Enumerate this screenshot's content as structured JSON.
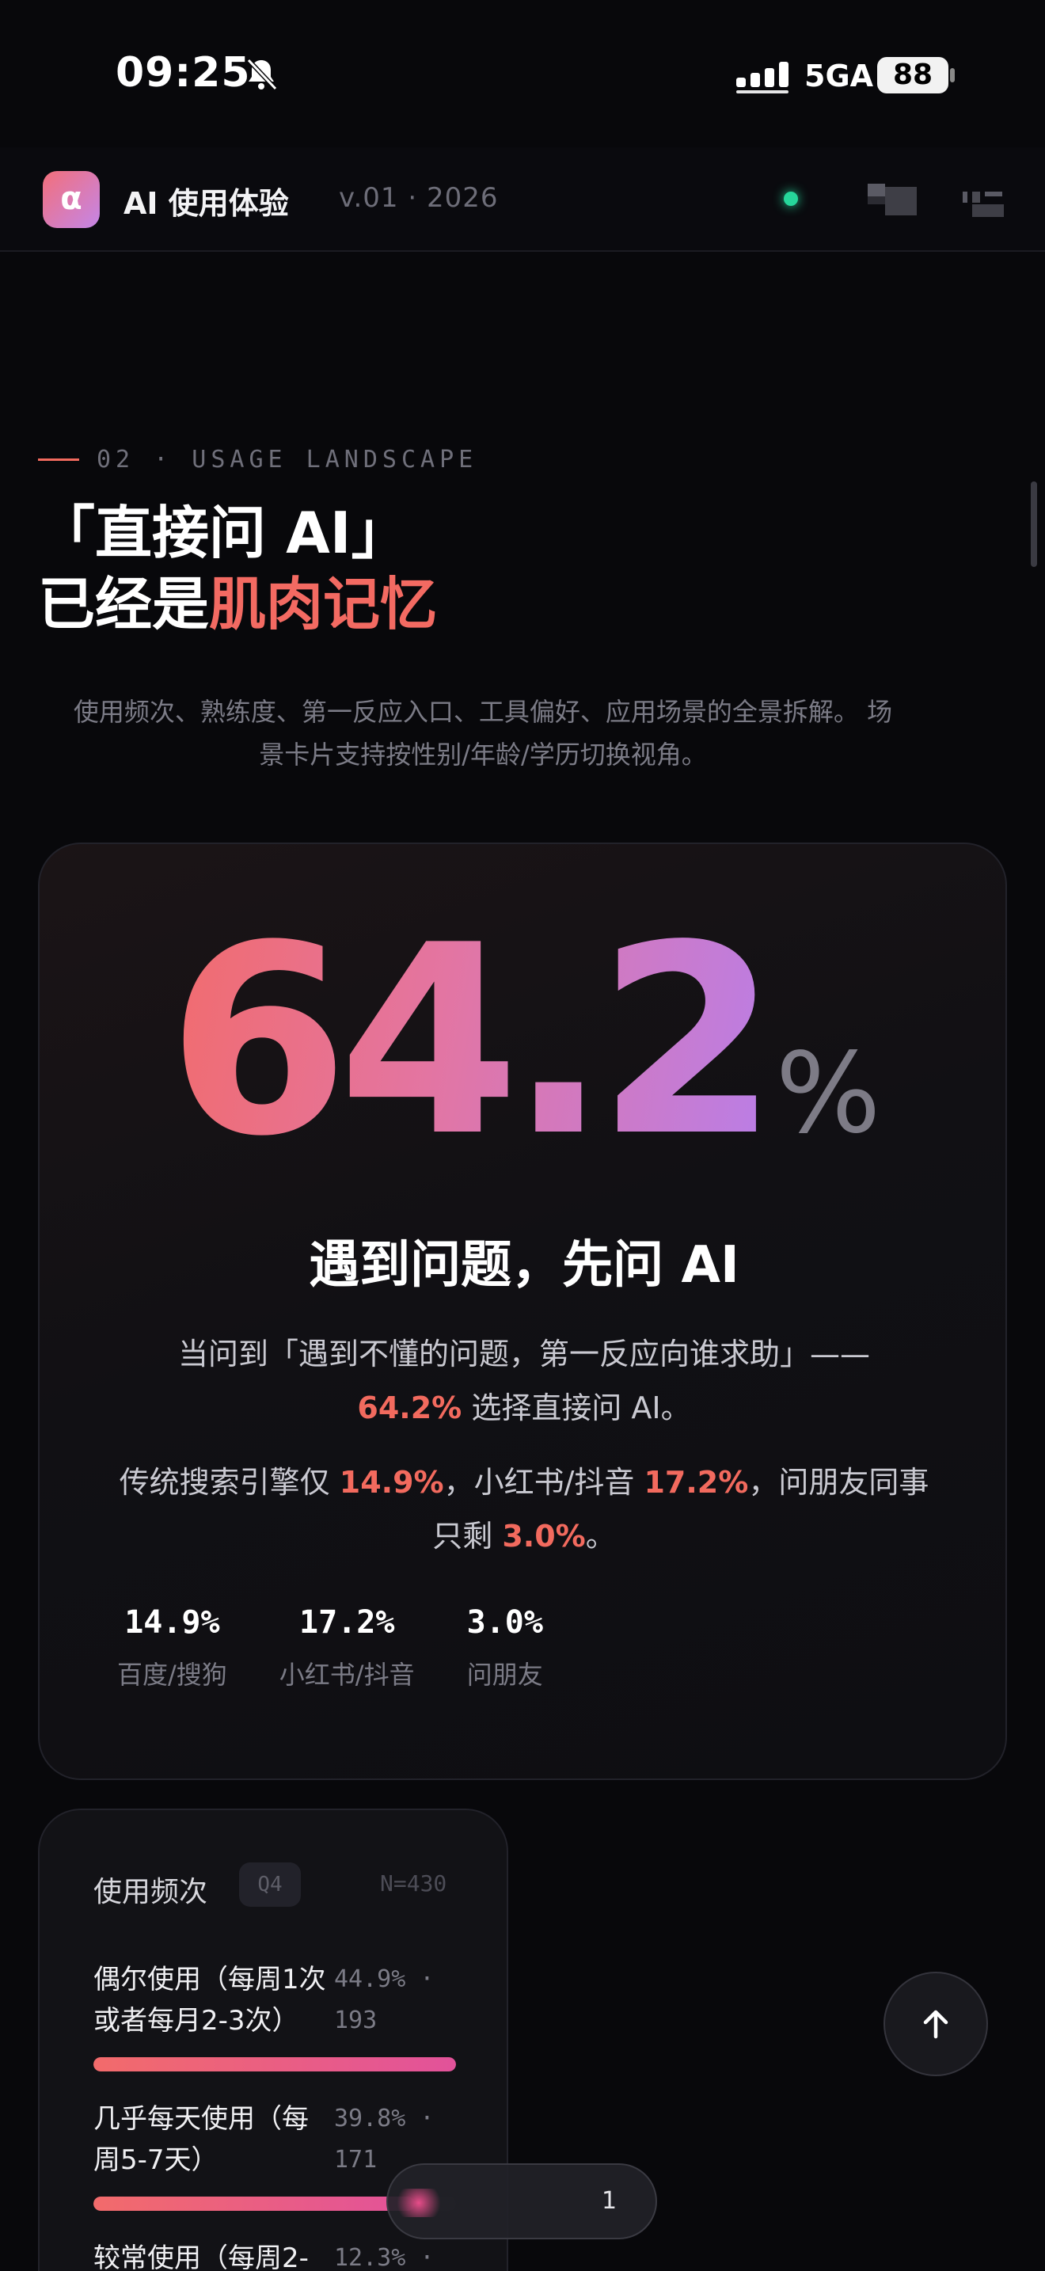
{
  "status_bar": {
    "time": "09:25",
    "network": "5GA",
    "battery": "88",
    "icons": [
      "bell-muted-icon",
      "signal-icon",
      "battery-icon"
    ]
  },
  "app": {
    "logo_glyph": "α",
    "title": "AI 使用体验",
    "version": "v.01 · 2026",
    "live_color": "#26d69a"
  },
  "section": {
    "eyebrow": "02 · USAGE LANDSCAPE",
    "headline_line1": "「直接问 AI」",
    "headline_line2_plain": "已经是",
    "headline_line2_accent": "肌肉记忆",
    "lede": "使用频次、熟练度、第一反应入口、工具偏好、应用场景的全景拆解。 场景卡片支持按性别/年龄/学历切换视角。"
  },
  "hero": {
    "value": "64.2",
    "unit": "%",
    "title": "遇到问题，先问 AI",
    "p1_text": "当问到「遇到不懂的问题，第一反应向谁求助」——",
    "p1_highlight": "64.2%",
    "p1_tail": " 选择直接问 AI。",
    "p2_a": "传统搜索引擎仅 ",
    "p2_h1": "14.9%",
    "p2_b": "，小红书/抖音 ",
    "p2_h2": "17.2%",
    "p2_c": "，问朋友同事只剩 ",
    "p2_h3": "3.0%",
    "p2_d": "。",
    "stats": [
      {
        "value": "14.9%",
        "label": "百度/搜狗"
      },
      {
        "value": "17.2%",
        "label": "小红书/抖音"
      },
      {
        "value": "3.0%",
        "label": "问朋友"
      }
    ],
    "accent_color": "#f26a5e"
  },
  "frequency": {
    "title": "使用频次",
    "tag": "Q4",
    "sample": "N=430",
    "rows": [
      {
        "label": "偶尔使用（每周1次或者每月2-3次）",
        "value": "44.9% · 193",
        "share": 0.449
      },
      {
        "label": "几乎每天使用（每周5-7天）",
        "value": "39.8% · 171",
        "share": 0.398
      },
      {
        "label": "较常使用（每周2-",
        "value": "12.3% ·",
        "share": 0.123
      }
    ]
  },
  "floating": {
    "toast_text": "1"
  }
}
